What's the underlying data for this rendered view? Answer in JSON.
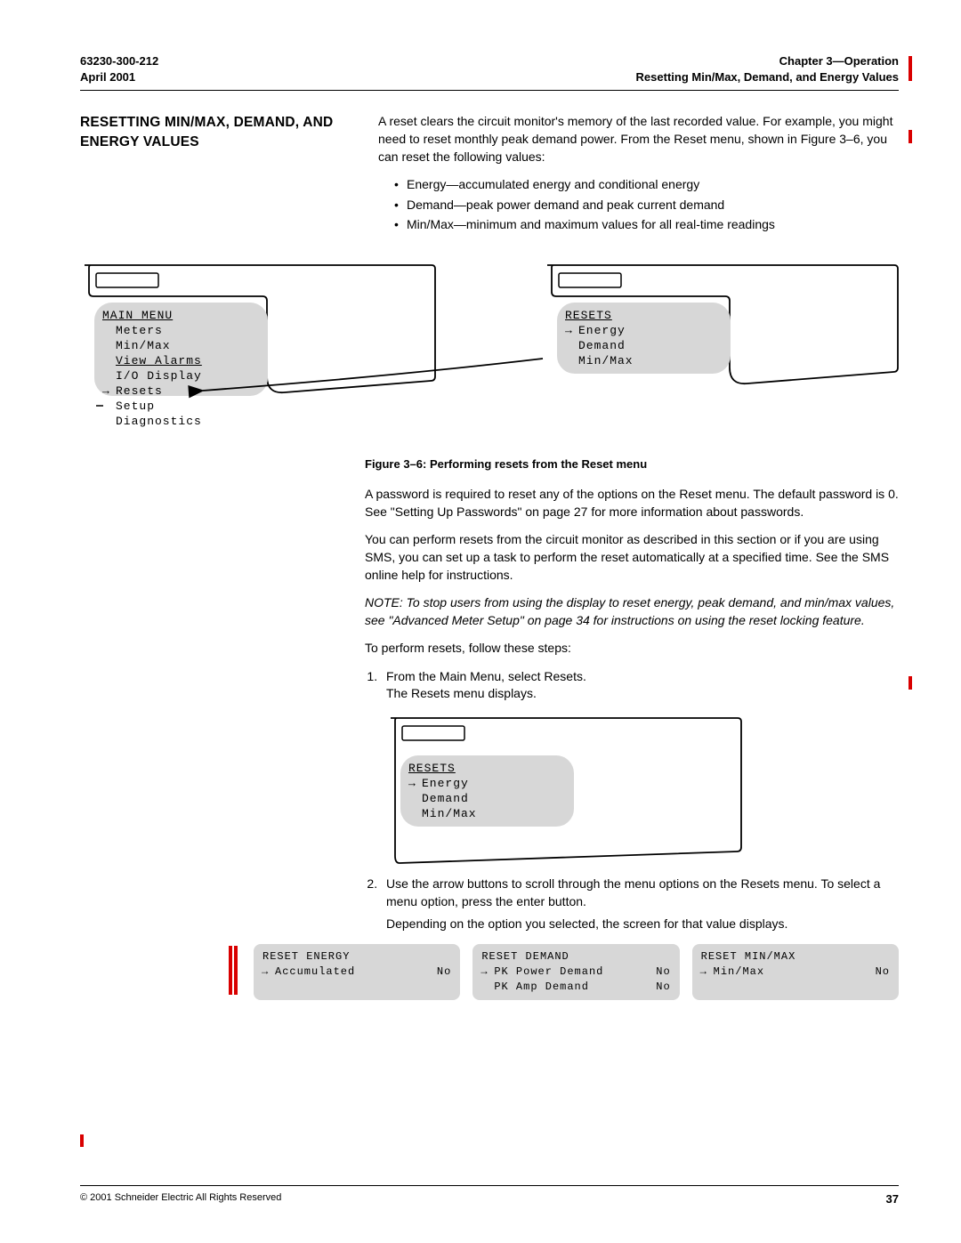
{
  "header": {
    "doc_num": "63230-300-212",
    "date": "April 2001",
    "chapter": "Chapter 3—Operation",
    "subtitle": "Resetting Min/Max, Demand, and Energy Values"
  },
  "section_title": "RESETTING MIN/MAX, DEMAND, AND ENERGY VALUES",
  "intro": "A reset clears the circuit monitor's memory of the last recorded value. For example, you might need to reset monthly peak demand power. From the Reset menu, shown in Figure 3–6, you can reset the following values:",
  "bullets": [
    "Energy—accumulated energy and conditional energy",
    "Demand—peak power demand and peak current demand",
    "Min/Max—minimum and maximum values for all real-time readings"
  ],
  "main_menu": {
    "title": "MAIN MENU",
    "items": [
      "Meters",
      "Min/Max",
      "View Alarms",
      "I/O Display",
      "Resets",
      "Setup",
      "Diagnostics"
    ],
    "selected": "Resets"
  },
  "resets_menu": {
    "title": "RESETS",
    "items": [
      "Energy",
      "Demand",
      "Min/Max"
    ],
    "selected": "Energy"
  },
  "figure_caption": "Figure 3–6:   Performing resets from the Reset menu",
  "p_password": "A password is required to reset any of the options on the Reset menu. The default password is 0. See \"Setting Up Passwords\" on page 27 for more information about passwords.",
  "p_sms": "You can perform resets from the circuit monitor as described in this section or if you are using SMS, you can set up a task to perform the reset automatically at a specified time. See the SMS online help for instructions.",
  "note": "NOTE: To stop users from using the display to reset energy, peak demand, and min/max values, see \"Advanced Meter Setup\" on page 34 for instructions on using the reset locking feature.",
  "p_steps": "To perform resets, follow these steps:",
  "step1a": "From the Main Menu, select Resets.",
  "step1b": "The Resets menu displays.",
  "step2a": "Use the arrow buttons to scroll through the menu options on the Resets menu. To select a menu option, press the enter button.",
  "step2b": "Depending on the option you selected, the screen for that value displays.",
  "reset_energy": {
    "title": "RESET ENERGY",
    "row1_label": "Accumulated",
    "row1_val": "No"
  },
  "reset_demand": {
    "title": "RESET DEMAND",
    "row1_label": "PK Power Demand",
    "row1_val": "No",
    "row2_label": "PK Amp Demand",
    "row2_val": "No"
  },
  "reset_minmax": {
    "title": "RESET MIN/MAX",
    "row1_label": "Min/Max",
    "row1_val": "No"
  },
  "footer": {
    "copyright": "© 2001 Schneider Electric  All Rights Reserved",
    "page": "37"
  }
}
